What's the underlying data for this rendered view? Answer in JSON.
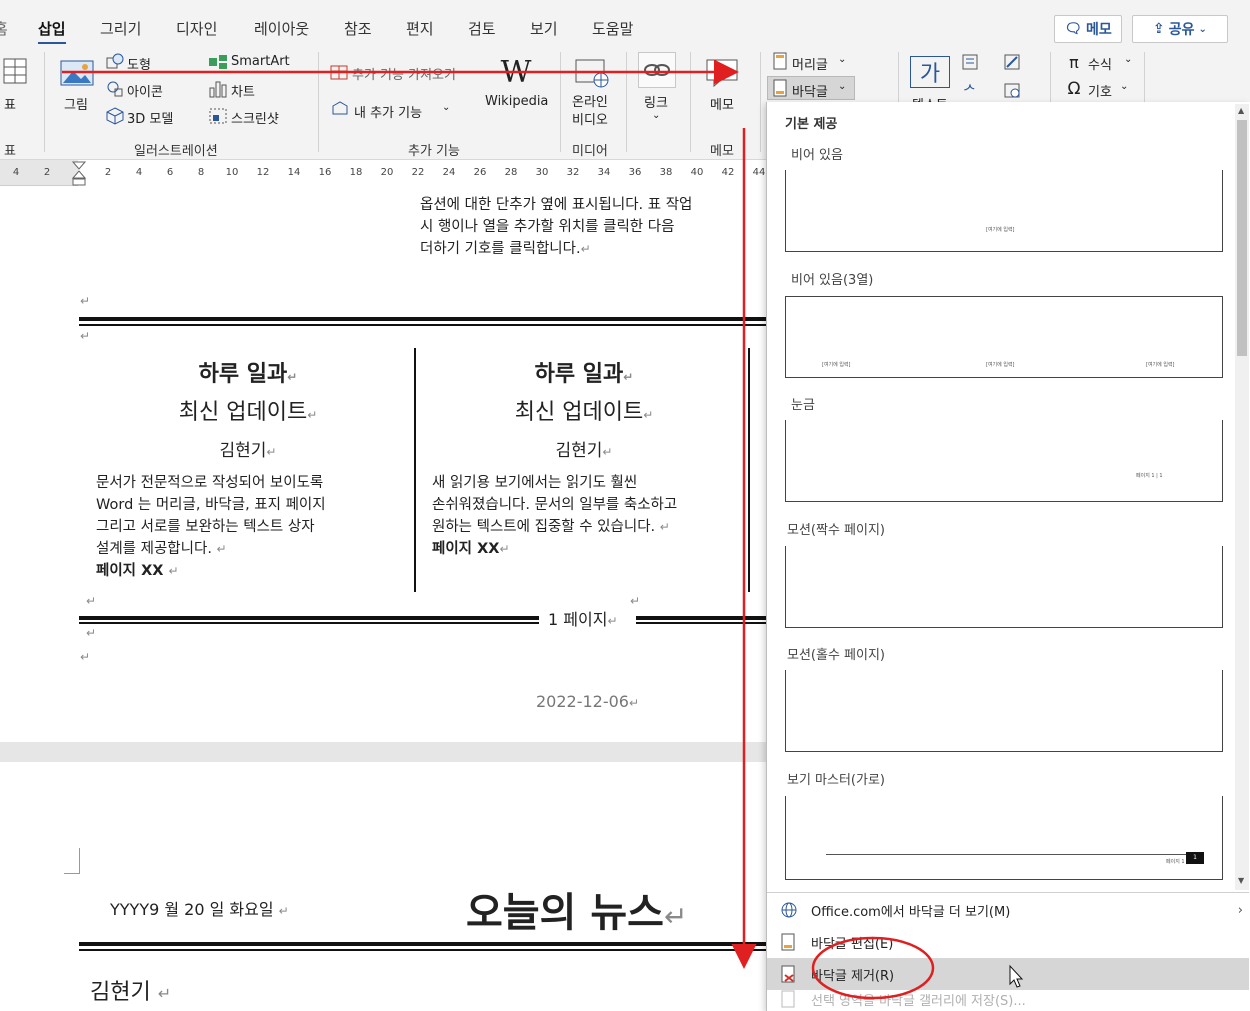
{
  "tabs": [
    "삽입",
    "그리기",
    "디자인",
    "레이아웃",
    "참조",
    "편지",
    "검토",
    "보기",
    "도움말"
  ],
  "top_buttons": {
    "memo": "메모",
    "share": "공유"
  },
  "ribbon": {
    "table_label": "표",
    "table_group": "표",
    "illustrations": {
      "picture": "그림",
      "shapes": "도형",
      "icons": "아이콘",
      "model3d": "3D 모델",
      "smartart": "SmartArt",
      "chart": "차트",
      "screenshot": "스크린샷",
      "group_label": "일러스트레이션"
    },
    "addins": {
      "get": "추가 기능 가져오기",
      "my": "내 추가 기능",
      "wikipedia": "Wikipedia",
      "group_label": "추가 기능"
    },
    "media": {
      "online_video": "온라인\n비디오",
      "group_label": "미디어"
    },
    "links": {
      "link": "링크"
    },
    "comments": {
      "comment": "메모",
      "group_label": "메모"
    },
    "header_footer": {
      "header": "머리글",
      "footer": "바닥글"
    },
    "text": {
      "textbox": "텍스트"
    },
    "symbols": {
      "equation": "수식",
      "symbol": "기호"
    }
  },
  "ruler_ticks": [
    "4",
    "2",
    "2",
    "4",
    "6",
    "8",
    "10",
    "12",
    "14",
    "16",
    "18",
    "20",
    "22",
    "24",
    "26",
    "28",
    "30",
    "32",
    "34",
    "36",
    "38",
    "40",
    "42",
    "44"
  ],
  "doc": {
    "top_paragraph": [
      "옵션에 대한 단추가 옆에 표시됩니다. 표 작업",
      "시 행이나 열을 추가할 위치를 클릭한 다음",
      "더하기 기호를 클릭합니다."
    ],
    "col1": {
      "title": "하루 일과",
      "subtitle": "최신 업데이트",
      "author": "김현기",
      "body": [
        "문서가 전문적으로 작성되어 보이도록",
        "Word 는 머리글, 바닥글, 표지 페이지",
        "그리고 서로를 보완하는 텍스트 상자",
        "설계를 제공합니다."
      ],
      "page": "페이지 XX"
    },
    "col2": {
      "title": "하루 일과",
      "subtitle": "최신 업데이트",
      "author": "김현기",
      "body": [
        "새 읽기용 보기에서는 읽기도 훨씬",
        "손쉬워졌습니다. 문서의 일부를 축소하고",
        "원하는 텍스트에 집중할 수 있습니다."
      ],
      "page": "페이지 XX"
    },
    "page_number": "1 페이지",
    "date": "2022-12-06",
    "page2": {
      "date_line": "YYYY9 월 20 일 화요일",
      "headline": "오늘의 뉴스",
      "author": "김현기"
    }
  },
  "gallery": {
    "section": "기본 제공",
    "items": [
      "비어 있음",
      "비어 있음(3열)",
      "눈금",
      "모션(짝수 페이지)",
      "모션(홀수 페이지)",
      "보기 마스터(가로)"
    ],
    "placeholder": "[여기에 입력]",
    "page_text": "페이지 1 | 1",
    "page_num": "1",
    "menu": [
      "Office.com에서 바닥글 더 보기(M)",
      "바닥글 편집(E)",
      "바닥글 제거(R)",
      "선택 영역을 바닥글 갤러리에 저장(S)..."
    ]
  },
  "colors": {
    "accent": "#2b579a",
    "annotation": "#e02020",
    "hover": "#d6d6d6"
  }
}
